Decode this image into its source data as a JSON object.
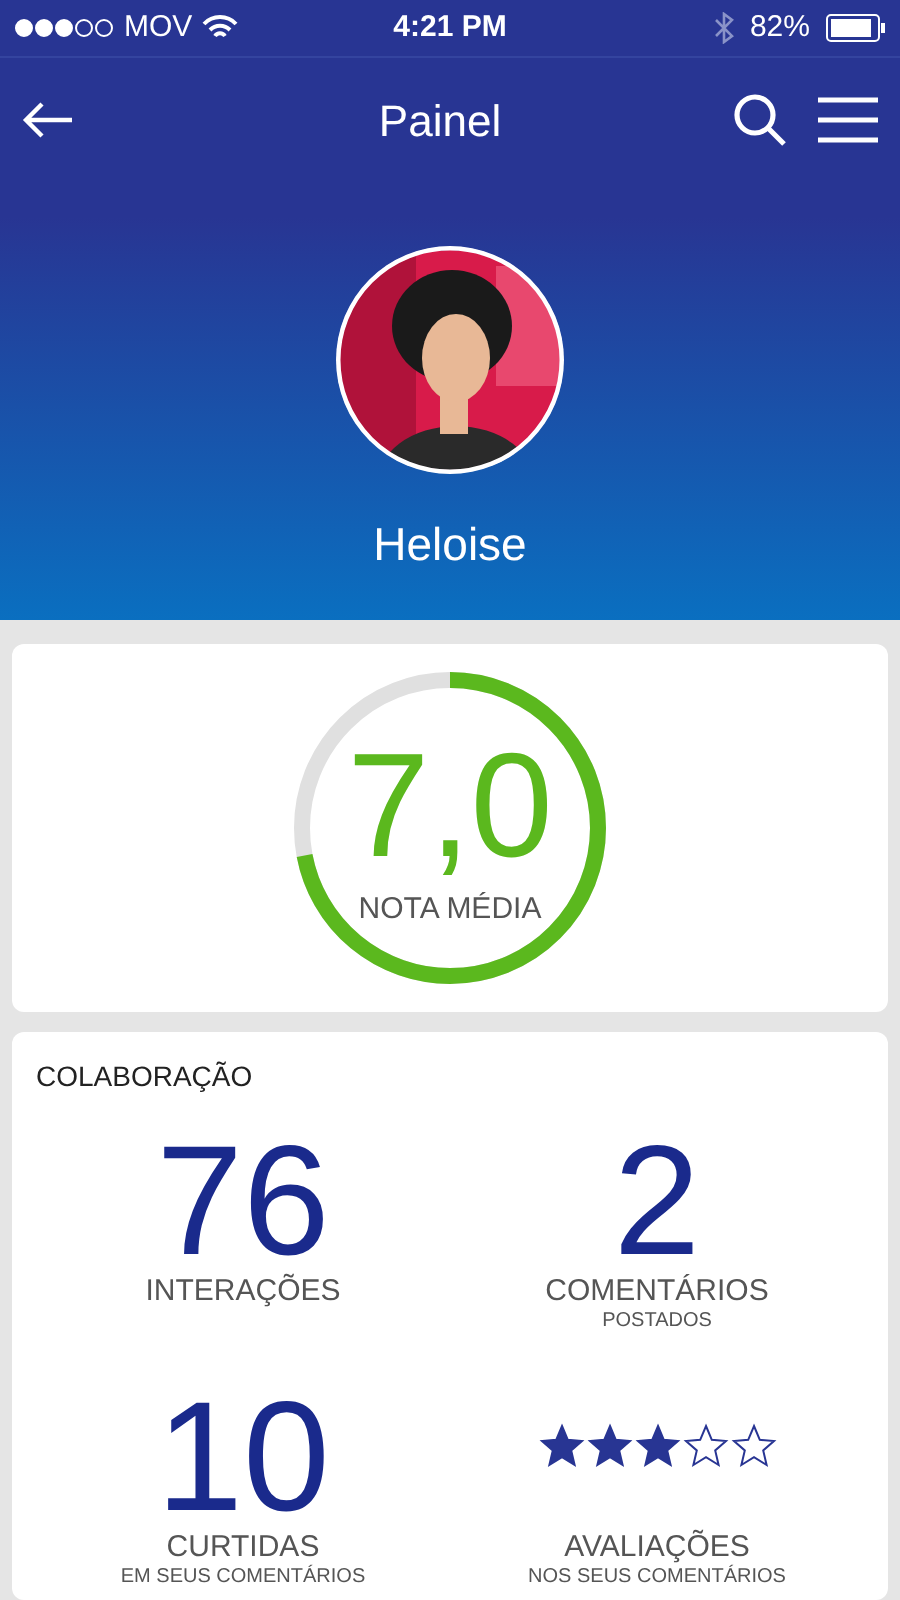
{
  "status_bar": {
    "carrier": "MOV",
    "time": "4:21 PM",
    "battery": "82%"
  },
  "header": {
    "title": "Painel"
  },
  "profile": {
    "name": "Heloise"
  },
  "score": {
    "value": "7,0",
    "label": "NOTA MÉDIA",
    "level": 0.72
  },
  "collaboration": {
    "title": "COLABORAÇÃO",
    "stats": [
      {
        "kind": "number",
        "value": "76",
        "label": "INTERAÇÕES"
      },
      {
        "kind": "number",
        "value": "2",
        "label": "COMENTÁRIOS",
        "sublabel": "POSTADOS"
      },
      {
        "kind": "number",
        "value": "10",
        "label": "CURTIDAS",
        "sublabel": "EM SEUS COMENTÁRIOS"
      },
      {
        "kind": "stars",
        "stars": 3,
        "label": "AVALIAÇÕES",
        "sublabel": "NOS SEUS COMENTÁRIOS"
      }
    ]
  }
}
